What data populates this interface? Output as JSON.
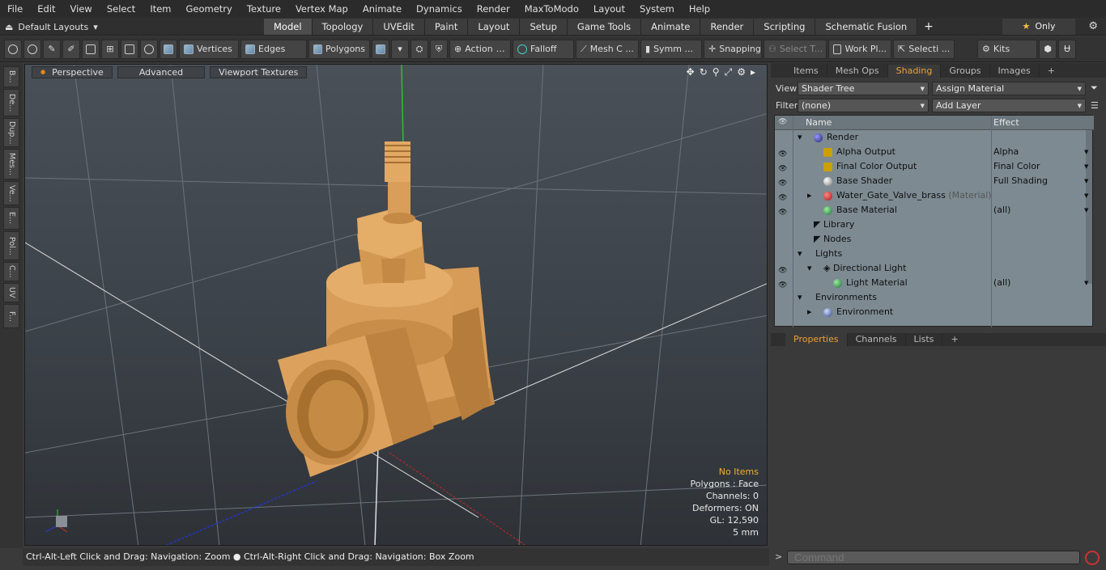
{
  "menubar": [
    "File",
    "Edit",
    "View",
    "Select",
    "Item",
    "Geometry",
    "Texture",
    "Vertex Map",
    "Animate",
    "Dynamics",
    "Render",
    "MaxToModo",
    "Layout",
    "System",
    "Help"
  ],
  "layouts": {
    "label": "Default Layouts"
  },
  "toptabs": [
    "Model",
    "Topology",
    "UVEdit",
    "Paint",
    "Layout",
    "Setup",
    "Game Tools",
    "Animate",
    "Render",
    "Scripting",
    "Schematic Fusion"
  ],
  "only_label": "Only",
  "toolbar": {
    "vertices": "Vertices",
    "edges": "Edges",
    "polygons": "Polygons",
    "action": "Action",
    "falloff": "Falloff",
    "mesh": "Mesh C ...",
    "symm": "Symm ...",
    "snapping": "Snapping",
    "select_t": "Select T...",
    "workpl": "Work Pl...",
    "selecti": "Selecti ...",
    "kits": "Kits"
  },
  "left_tabs": [
    "B...",
    "De...",
    "Dup...",
    "Mes...",
    "Ve...",
    "E...",
    "Pol...",
    "C...",
    "UV",
    "F..."
  ],
  "viewport": {
    "perspective": "Perspective",
    "advanced": "Advanced",
    "textures": "Viewport Textures"
  },
  "info": {
    "items": "No Items",
    "polygons": "Polygons : Face",
    "channels": "Channels: 0",
    "deformers": "Deformers: ON",
    "gl": "GL: 12,590",
    "scale": "5 mm"
  },
  "status": "Ctrl-Alt-Left Click and Drag: Navigation: Zoom ● Ctrl-Alt-Right Click and Drag: Navigation: Box Zoom",
  "panel_tabs": [
    "Items",
    "Mesh Ops",
    "Shading",
    "Groups",
    "Images"
  ],
  "view_row": {
    "label": "View",
    "value": "Shader Tree",
    "assign": "Assign Material"
  },
  "filter_row": {
    "label": "Filter",
    "value": "(none)",
    "add": "Add Layer"
  },
  "tree_header": {
    "name": "Name",
    "effect": "Effect"
  },
  "tree": [
    {
      "name": "Render",
      "effect": "",
      "sub": ""
    },
    {
      "name": "Alpha Output",
      "effect": "Alpha",
      "sub": ""
    },
    {
      "name": "Final Color Output",
      "effect": "Final Color",
      "sub": ""
    },
    {
      "name": "Base Shader",
      "effect": "Full Shading",
      "sub": ""
    },
    {
      "name": "Water_Gate_Valve_brass",
      "effect": "",
      "sub": "(Material)"
    },
    {
      "name": "Base Material",
      "effect": "(all)",
      "sub": ""
    },
    {
      "name": "Library",
      "effect": "",
      "sub": ""
    },
    {
      "name": "Nodes",
      "effect": "",
      "sub": ""
    },
    {
      "name": "Lights",
      "effect": "",
      "sub": ""
    },
    {
      "name": "Directional Light",
      "effect": "",
      "sub": ""
    },
    {
      "name": "Light Material",
      "effect": "(all)",
      "sub": ""
    },
    {
      "name": "Environments",
      "effect": "",
      "sub": ""
    },
    {
      "name": "Environment",
      "effect": "",
      "sub": ""
    }
  ],
  "props_tabs": [
    "Properties",
    "Channels",
    "Lists"
  ],
  "command": {
    "placeholder": "Command"
  },
  "colors": {
    "accent": "#f0a030",
    "brass": "#d9a05a"
  }
}
